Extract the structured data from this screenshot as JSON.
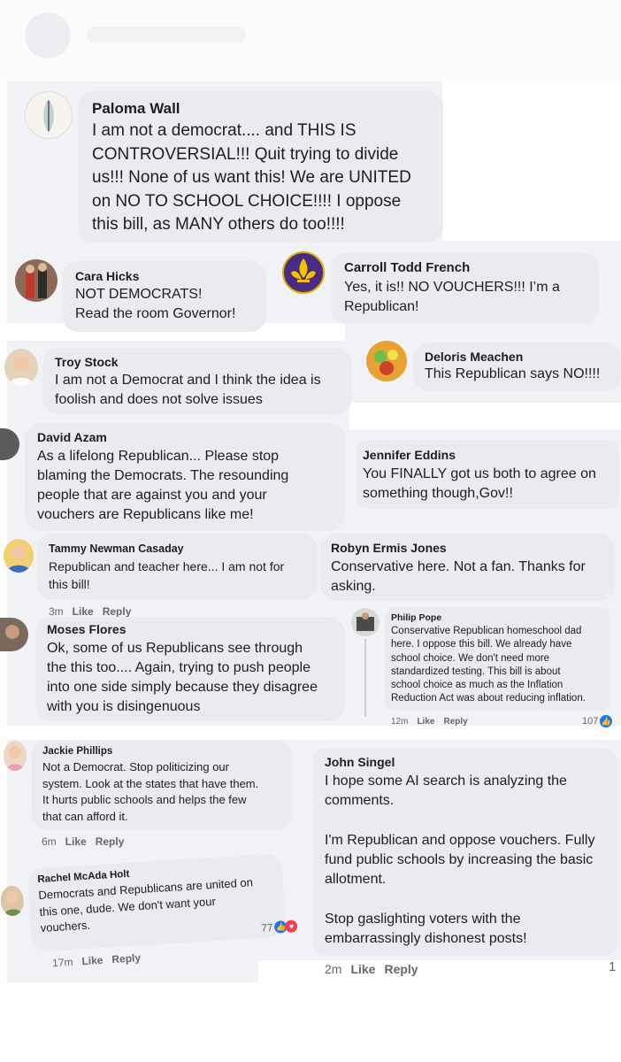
{
  "header": {
    "title": ""
  },
  "comments": [
    {
      "name": "Paloma Wall",
      "text": "I am not a democrat.... and THIS IS\nCONTROVERSIAL!!! Quit trying to divide\nus!!! None of us want this! We are UNITED\non NO TO SCHOOL CHOICE!!!! I oppose\nthis bill, as MANY others do too!!!!"
    },
    {
      "name": "Cara Hicks",
      "text": "NOT DEMOCRATS!\nRead the room Governor!"
    },
    {
      "name": "Carroll Todd French",
      "text": "Yes, it is!! NO VOUCHERS!!!  I’m a\nRepublican!"
    },
    {
      "name": "Troy Stock",
      "text": "I am not a Democrat and I think the idea is\nfoolish and does not solve issues"
    },
    {
      "name": "Deloris Meachen",
      "text": "This Republican says NO!!!!"
    },
    {
      "name": "David Azam",
      "text": "As a lifelong Republican... Please stop\nblaming the Democrats. The resounding\npeople that are against you and your\nvouchers are Republicans like me!"
    },
    {
      "name": "Jennifer Eddins",
      "text": "You FINALLY got us both to agree on\nsomething though,Gov!!"
    },
    {
      "name": "Tammy Newman Casaday",
      "text": "Republican and teacher here... I am not for\nthis bill!",
      "time": "3m"
    },
    {
      "name": "Robyn Ermis Jones",
      "text": "Conservative here. Not a fan. Thanks for\nasking."
    },
    {
      "name": "Moses Flores",
      "text": "Ok, some of us Republicans see through\nthe this too.... Again, trying to push people\ninto one side simply because they disagree\nwith you is disingenuous"
    },
    {
      "name": "Philip Pope",
      "text": "Conservative Republican homeschool dad\nhere. I oppose this bill. We already have\nschool choice. We don't need more\nstandardized testing. This bill is about\nschool choice as much as the Inflation\nReduction Act was about reducing inflation.",
      "time": "12m",
      "reactions": "107"
    },
    {
      "name": "Jackie Phillips",
      "text": "Not a Democrat. Stop politicizing our\nsystem. Look at the states that have them.\nIt hurts public schools and helps the few\nthat can afford it.",
      "time": "6m"
    },
    {
      "name": "John Singel",
      "text": "I hope some AI search is analyzing the\ncomments.\n\nI'm Republican and oppose vouchers. Fully\nfund public schools by increasing the basic\nallotment.\n\nStop gaslighting voters with the\nembarrassingly dishonest posts!",
      "time": "2m",
      "reactions": "1"
    },
    {
      "name": "Rachel McAda Holt",
      "text": "Democrats and Republicans are united on\nthis one, dude.  We don't want your\nvouchers.",
      "time": "17m",
      "reactions": "77"
    }
  ],
  "actions": {
    "like": "Like",
    "reply": "Reply"
  },
  "colors": {
    "bubble": "#e9ebee",
    "like": "#1877f2",
    "love": "#f33e58"
  }
}
